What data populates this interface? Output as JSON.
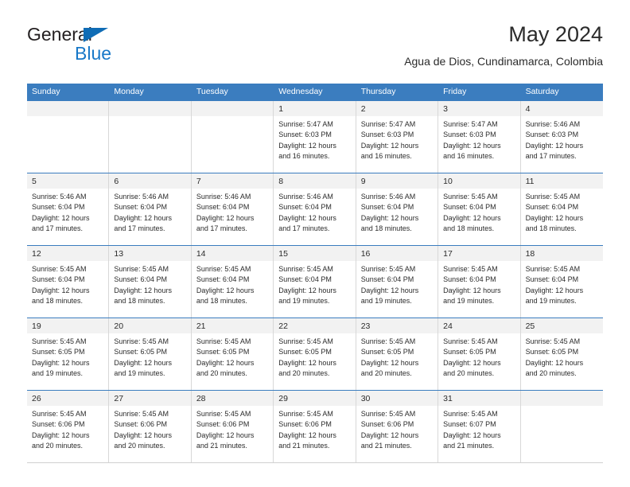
{
  "brand": {
    "name_top": "General",
    "name_bottom": "Blue",
    "colors": {
      "top_text": "#231f20",
      "bottom_text": "#1878c8",
      "triangle": "#0f6cb5"
    }
  },
  "header": {
    "title": "May 2024",
    "subtitle": "Agua de Dios, Cundinamarca, Colombia"
  },
  "theme": {
    "header_bg": "#3b7dbf",
    "header_text": "#ffffff",
    "daynum_band_bg": "#f2f2f2",
    "cell_bg": "#ffffff",
    "grid_line": "#d8d8d8",
    "week_rule": "#3b7dbf",
    "body_text": "#2b2b2b"
  },
  "weekdays": [
    "Sunday",
    "Monday",
    "Tuesday",
    "Wednesday",
    "Thursday",
    "Friday",
    "Saturday"
  ],
  "weeks": [
    [
      {
        "day": "",
        "lines": []
      },
      {
        "day": "",
        "lines": []
      },
      {
        "day": "",
        "lines": []
      },
      {
        "day": "1",
        "lines": [
          "Sunrise: 5:47 AM",
          "Sunset: 6:03 PM",
          "Daylight: 12 hours",
          "and 16 minutes."
        ]
      },
      {
        "day": "2",
        "lines": [
          "Sunrise: 5:47 AM",
          "Sunset: 6:03 PM",
          "Daylight: 12 hours",
          "and 16 minutes."
        ]
      },
      {
        "day": "3",
        "lines": [
          "Sunrise: 5:47 AM",
          "Sunset: 6:03 PM",
          "Daylight: 12 hours",
          "and 16 minutes."
        ]
      },
      {
        "day": "4",
        "lines": [
          "Sunrise: 5:46 AM",
          "Sunset: 6:03 PM",
          "Daylight: 12 hours",
          "and 17 minutes."
        ]
      }
    ],
    [
      {
        "day": "5",
        "lines": [
          "Sunrise: 5:46 AM",
          "Sunset: 6:04 PM",
          "Daylight: 12 hours",
          "and 17 minutes."
        ]
      },
      {
        "day": "6",
        "lines": [
          "Sunrise: 5:46 AM",
          "Sunset: 6:04 PM",
          "Daylight: 12 hours",
          "and 17 minutes."
        ]
      },
      {
        "day": "7",
        "lines": [
          "Sunrise: 5:46 AM",
          "Sunset: 6:04 PM",
          "Daylight: 12 hours",
          "and 17 minutes."
        ]
      },
      {
        "day": "8",
        "lines": [
          "Sunrise: 5:46 AM",
          "Sunset: 6:04 PM",
          "Daylight: 12 hours",
          "and 17 minutes."
        ]
      },
      {
        "day": "9",
        "lines": [
          "Sunrise: 5:46 AM",
          "Sunset: 6:04 PM",
          "Daylight: 12 hours",
          "and 18 minutes."
        ]
      },
      {
        "day": "10",
        "lines": [
          "Sunrise: 5:45 AM",
          "Sunset: 6:04 PM",
          "Daylight: 12 hours",
          "and 18 minutes."
        ]
      },
      {
        "day": "11",
        "lines": [
          "Sunrise: 5:45 AM",
          "Sunset: 6:04 PM",
          "Daylight: 12 hours",
          "and 18 minutes."
        ]
      }
    ],
    [
      {
        "day": "12",
        "lines": [
          "Sunrise: 5:45 AM",
          "Sunset: 6:04 PM",
          "Daylight: 12 hours",
          "and 18 minutes."
        ]
      },
      {
        "day": "13",
        "lines": [
          "Sunrise: 5:45 AM",
          "Sunset: 6:04 PM",
          "Daylight: 12 hours",
          "and 18 minutes."
        ]
      },
      {
        "day": "14",
        "lines": [
          "Sunrise: 5:45 AM",
          "Sunset: 6:04 PM",
          "Daylight: 12 hours",
          "and 18 minutes."
        ]
      },
      {
        "day": "15",
        "lines": [
          "Sunrise: 5:45 AM",
          "Sunset: 6:04 PM",
          "Daylight: 12 hours",
          "and 19 minutes."
        ]
      },
      {
        "day": "16",
        "lines": [
          "Sunrise: 5:45 AM",
          "Sunset: 6:04 PM",
          "Daylight: 12 hours",
          "and 19 minutes."
        ]
      },
      {
        "day": "17",
        "lines": [
          "Sunrise: 5:45 AM",
          "Sunset: 6:04 PM",
          "Daylight: 12 hours",
          "and 19 minutes."
        ]
      },
      {
        "day": "18",
        "lines": [
          "Sunrise: 5:45 AM",
          "Sunset: 6:04 PM",
          "Daylight: 12 hours",
          "and 19 minutes."
        ]
      }
    ],
    [
      {
        "day": "19",
        "lines": [
          "Sunrise: 5:45 AM",
          "Sunset: 6:05 PM",
          "Daylight: 12 hours",
          "and 19 minutes."
        ]
      },
      {
        "day": "20",
        "lines": [
          "Sunrise: 5:45 AM",
          "Sunset: 6:05 PM",
          "Daylight: 12 hours",
          "and 19 minutes."
        ]
      },
      {
        "day": "21",
        "lines": [
          "Sunrise: 5:45 AM",
          "Sunset: 6:05 PM",
          "Daylight: 12 hours",
          "and 20 minutes."
        ]
      },
      {
        "day": "22",
        "lines": [
          "Sunrise: 5:45 AM",
          "Sunset: 6:05 PM",
          "Daylight: 12 hours",
          "and 20 minutes."
        ]
      },
      {
        "day": "23",
        "lines": [
          "Sunrise: 5:45 AM",
          "Sunset: 6:05 PM",
          "Daylight: 12 hours",
          "and 20 minutes."
        ]
      },
      {
        "day": "24",
        "lines": [
          "Sunrise: 5:45 AM",
          "Sunset: 6:05 PM",
          "Daylight: 12 hours",
          "and 20 minutes."
        ]
      },
      {
        "day": "25",
        "lines": [
          "Sunrise: 5:45 AM",
          "Sunset: 6:05 PM",
          "Daylight: 12 hours",
          "and 20 minutes."
        ]
      }
    ],
    [
      {
        "day": "26",
        "lines": [
          "Sunrise: 5:45 AM",
          "Sunset: 6:06 PM",
          "Daylight: 12 hours",
          "and 20 minutes."
        ]
      },
      {
        "day": "27",
        "lines": [
          "Sunrise: 5:45 AM",
          "Sunset: 6:06 PM",
          "Daylight: 12 hours",
          "and 20 minutes."
        ]
      },
      {
        "day": "28",
        "lines": [
          "Sunrise: 5:45 AM",
          "Sunset: 6:06 PM",
          "Daylight: 12 hours",
          "and 21 minutes."
        ]
      },
      {
        "day": "29",
        "lines": [
          "Sunrise: 5:45 AM",
          "Sunset: 6:06 PM",
          "Daylight: 12 hours",
          "and 21 minutes."
        ]
      },
      {
        "day": "30",
        "lines": [
          "Sunrise: 5:45 AM",
          "Sunset: 6:06 PM",
          "Daylight: 12 hours",
          "and 21 minutes."
        ]
      },
      {
        "day": "31",
        "lines": [
          "Sunrise: 5:45 AM",
          "Sunset: 6:07 PM",
          "Daylight: 12 hours",
          "and 21 minutes."
        ]
      },
      {
        "day": "",
        "lines": []
      }
    ]
  ]
}
